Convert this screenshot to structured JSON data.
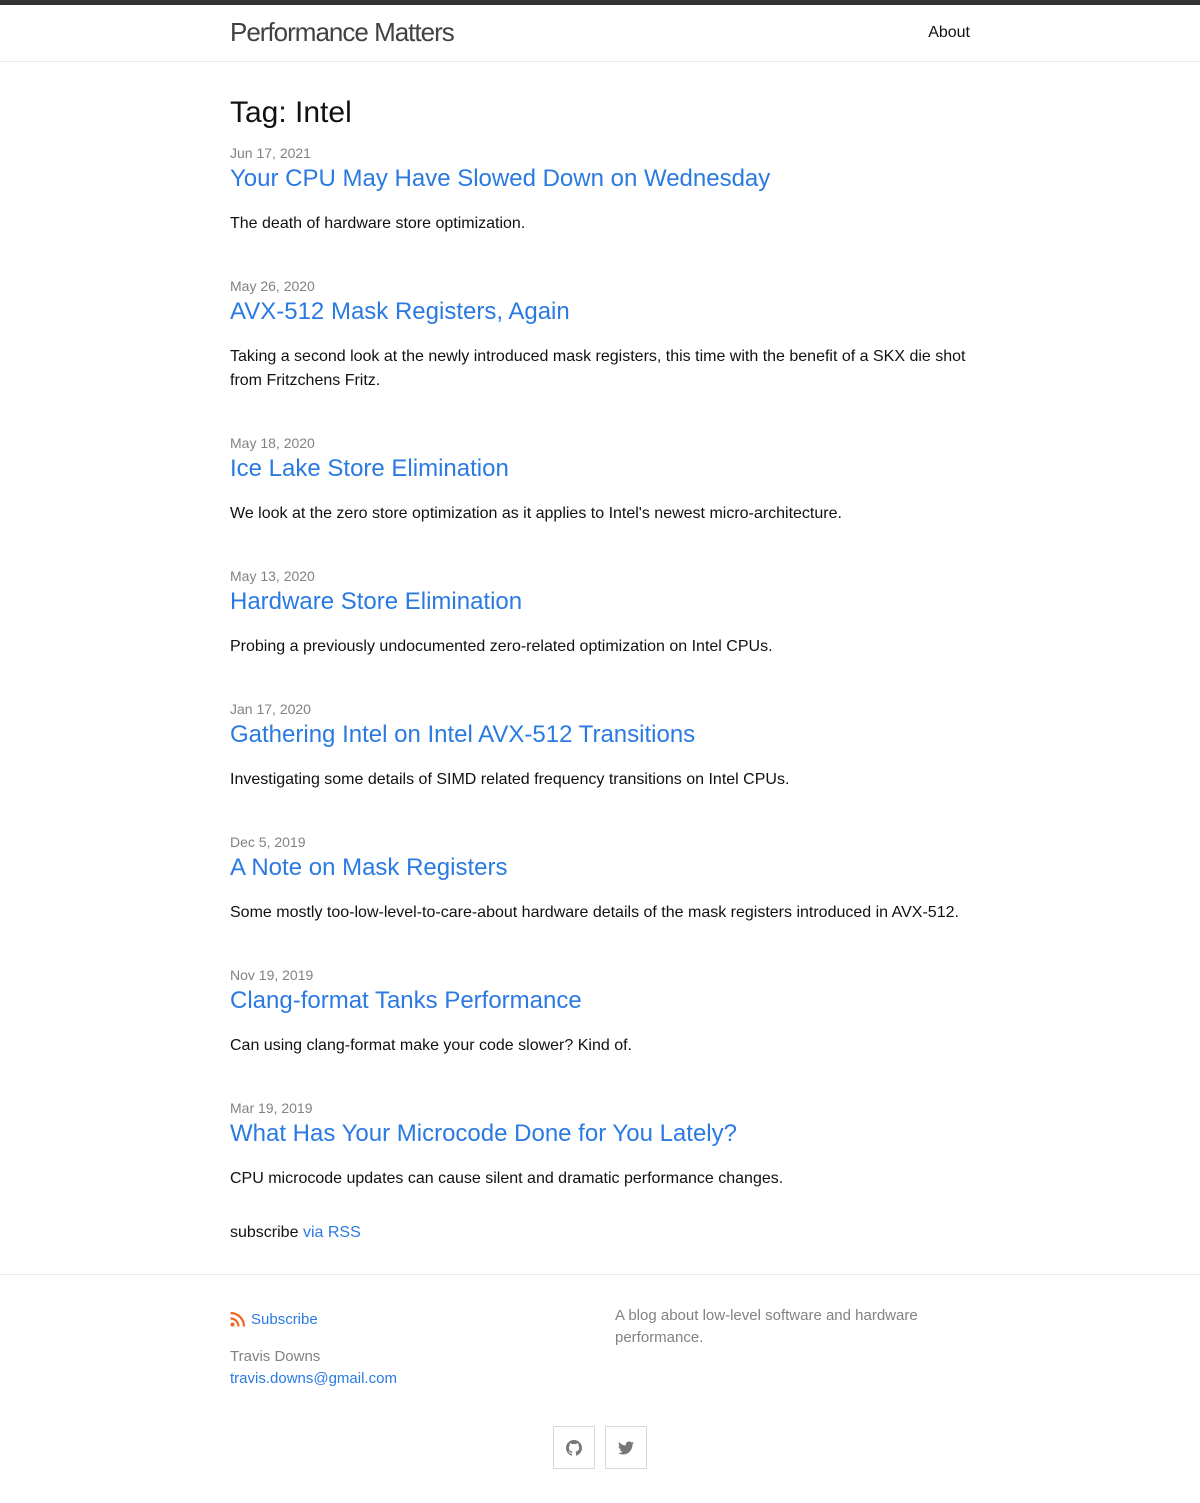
{
  "header": {
    "site_title": "Performance Matters",
    "nav": [
      {
        "label": "About"
      }
    ]
  },
  "main": {
    "page_heading": "Tag: Intel",
    "posts": [
      {
        "date": "Jun 17, 2021",
        "title": "Your CPU May Have Slowed Down on Wednesday",
        "excerpt": "The death of hardware store optimization."
      },
      {
        "date": "May 26, 2020",
        "title": "AVX-512 Mask Registers, Again",
        "excerpt": "Taking a second look at the newly introduced mask registers, this time with the benefit of a SKX die shot from Fritzchens Fritz."
      },
      {
        "date": "May 18, 2020",
        "title": "Ice Lake Store Elimination",
        "excerpt": "We look at the zero store optimization as it applies to Intel's newest micro-architecture."
      },
      {
        "date": "May 13, 2020",
        "title": "Hardware Store Elimination",
        "excerpt": "Probing a previously undocumented zero-related optimization on Intel CPUs."
      },
      {
        "date": "Jan 17, 2020",
        "title": "Gathering Intel on Intel AVX-512 Transitions",
        "excerpt": "Investigating some details of SIMD related frequency transitions on Intel CPUs."
      },
      {
        "date": "Dec 5, 2019",
        "title": "A Note on Mask Registers",
        "excerpt": "Some mostly too-low-level-to-care-about hardware details of the mask registers introduced in AVX-512."
      },
      {
        "date": "Nov 19, 2019",
        "title": "Clang-format Tanks Performance",
        "excerpt": "Can using clang-format make your code slower? Kind of."
      },
      {
        "date": "Mar 19, 2019",
        "title": "What Has Your Microcode Done for You Lately?",
        "excerpt": "CPU microcode updates can cause silent and dramatic performance changes."
      }
    ],
    "rss": {
      "prefix": "subscribe",
      "link_label": "via RSS"
    }
  },
  "footer": {
    "subscribe_label": "Subscribe",
    "author_name": "Travis Downs",
    "author_email": "travis.downs@gmail.com",
    "description": "A blog about low-level software and hardware performance.",
    "social": [
      {
        "icon": "github-icon"
      },
      {
        "icon": "twitter-icon"
      }
    ]
  },
  "colors": {
    "link": "#2a7ae2",
    "meta": "#828282",
    "topbar": "#333333",
    "rss_orange": "#f26522"
  }
}
